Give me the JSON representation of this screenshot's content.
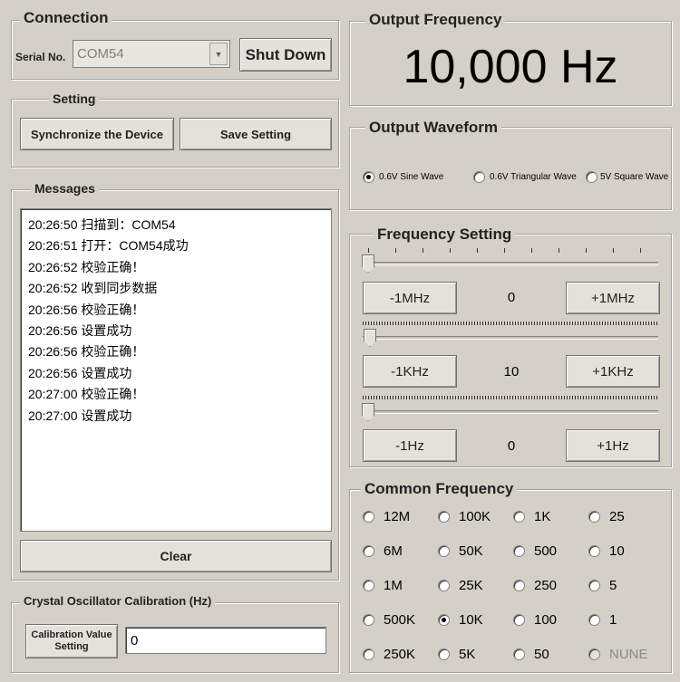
{
  "connection": {
    "title": "Connection",
    "serial_label": "Serial No.",
    "serial_value": "COM54",
    "shutdown_label": "Shut Down"
  },
  "setting": {
    "title": "Setting",
    "sync_label": "Synchronize the Device",
    "save_label": "Save Setting"
  },
  "messages": {
    "title": "Messages",
    "lines": [
      "20:26:50 扫描到：COM54",
      "20:26:51 打开：COM54成功",
      "20:26:52 校验正确！",
      "20:26:52 收到同步数据",
      "20:26:56 校验正确！",
      "20:26:56 设置成功",
      "20:26:56 校验正确！",
      "20:26:56 设置成功",
      "20:27:00 校验正确！",
      "20:27:00 设置成功"
    ],
    "clear_label": "Clear"
  },
  "calibration": {
    "title": "Crystal Oscillator Calibration (Hz)",
    "button_label_line1": "Calibration Value",
    "button_label_line2": "Setting",
    "value": "0"
  },
  "output_frequency": {
    "title": "Output Frequency",
    "value": "10,000 Hz"
  },
  "output_waveform": {
    "title": "Output Waveform",
    "options": [
      "0.6V Sine Wave",
      "0.6V Triangular Wave",
      "5V Square Wave"
    ],
    "selected": 0
  },
  "frequency_setting": {
    "title": "Frequency Setting",
    "rows": [
      {
        "minus": "-1MHz",
        "value": "0",
        "plus": "+1MHz"
      },
      {
        "minus": "-1KHz",
        "value": "10",
        "plus": "+1KHz"
      },
      {
        "minus": "-1Hz",
        "value": "0",
        "plus": "+1Hz"
      }
    ]
  },
  "common_frequency": {
    "title": "Common Frequency",
    "columns": [
      [
        "12M",
        "6M",
        "1M",
        "500K",
        "250K"
      ],
      [
        "100K",
        "50K",
        "25K",
        "10K",
        "5K"
      ],
      [
        "1K",
        "500",
        "250",
        "100",
        "50"
      ],
      [
        "25",
        "10",
        "5",
        "1",
        "NUNE"
      ]
    ],
    "selected": "10K",
    "disabled": "NUNE"
  }
}
